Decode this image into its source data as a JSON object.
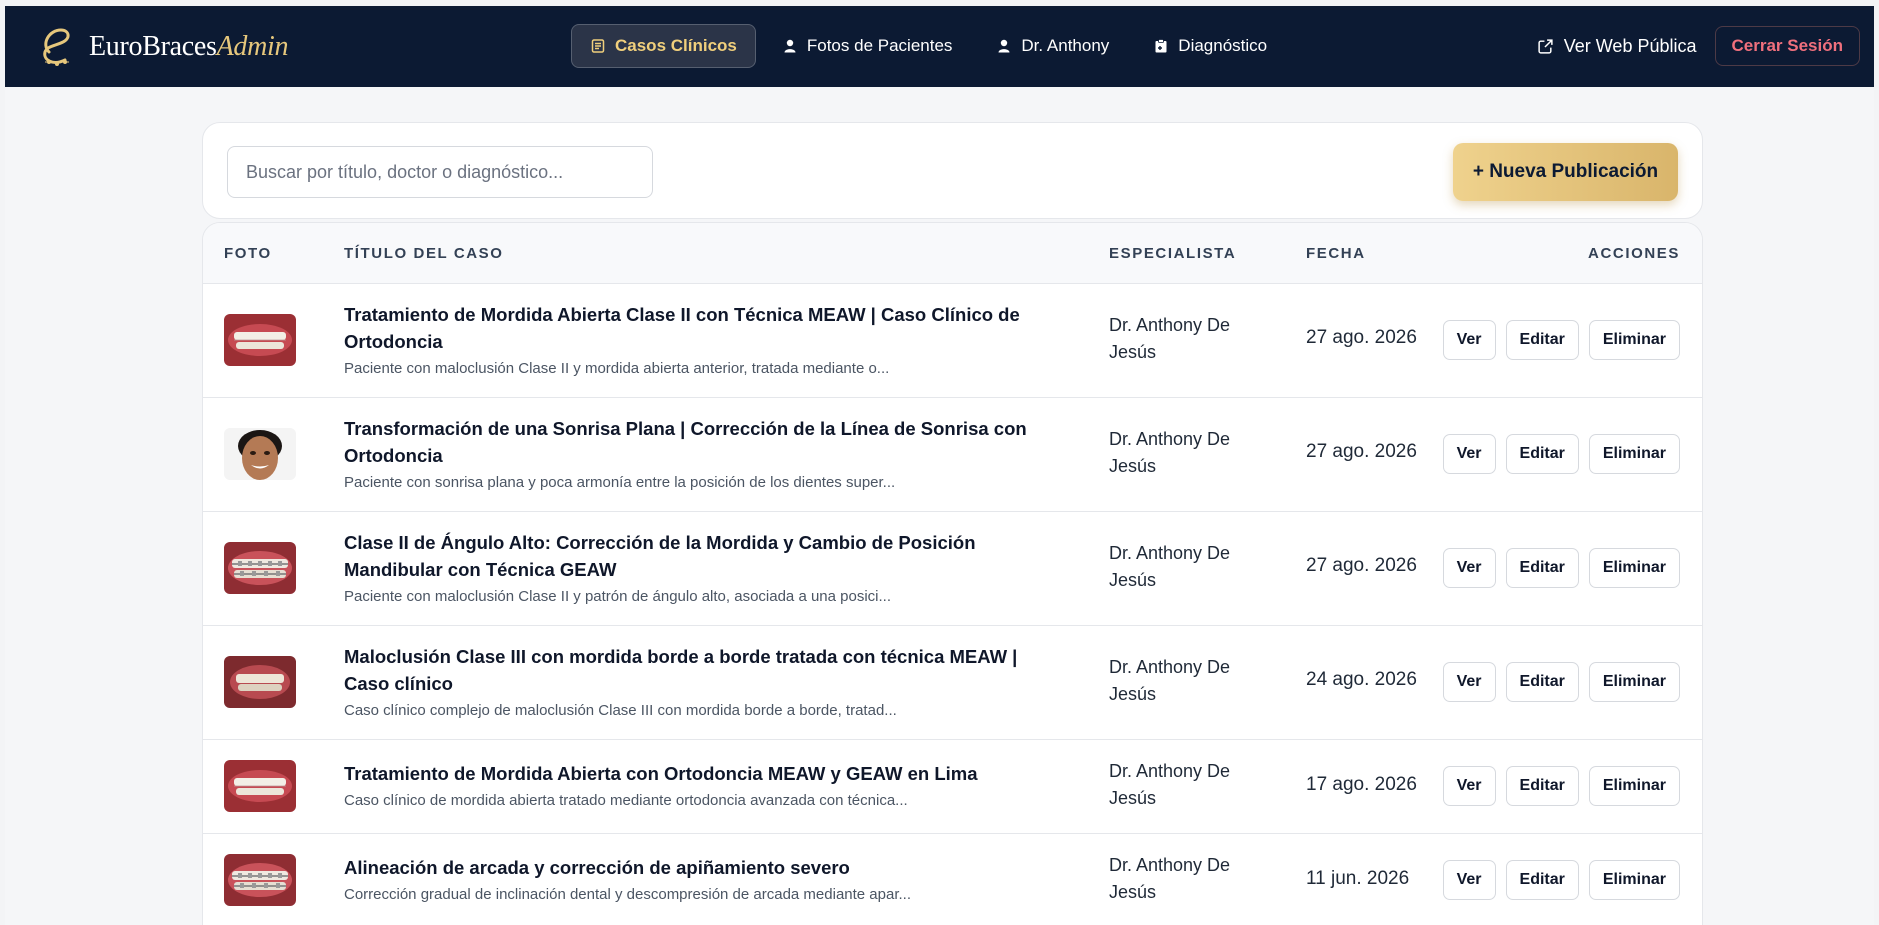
{
  "brand": {
    "name": "EuroBraces",
    "accent": "Admin",
    "logo_icon": "e-monogram-icon"
  },
  "nav": {
    "items": [
      {
        "label": "Casos Clínicos",
        "icon": "document-icon",
        "active": true
      },
      {
        "label": "Fotos de Pacientes",
        "icon": "user-icon"
      },
      {
        "label": "Dr. Anthony",
        "icon": "user-icon"
      },
      {
        "label": "Diagnóstico",
        "icon": "clipboard-icon"
      }
    ],
    "public_link": "Ver Web Pública",
    "logout": "Cerrar Sesión"
  },
  "toolbar": {
    "search_placeholder": "Buscar por título, doctor o diagnóstico...",
    "new_button": "+ Nueva Publicación"
  },
  "table": {
    "headers": {
      "photo": "FOTO",
      "title": "TÍTULO DEL CASO",
      "specialist": "ESPECIALISTA",
      "date": "FECHA",
      "actions": "ACCIONES"
    },
    "action_labels": {
      "view": "Ver",
      "edit": "Editar",
      "delete": "Eliminar"
    },
    "rows": [
      {
        "title": "Tratamiento de Mordida Abierta Clase II con Técnica MEAW | Caso Clínico de Ortodoncia",
        "desc": "Paciente con maloclusión Clase II y mordida abierta anterior, tratada mediante o...",
        "specialist": "Dr. Anthony De Jesús",
        "date": "27 ago. 2026",
        "thumb": "teeth"
      },
      {
        "title": "Transformación de una Sonrisa Plana | Corrección de la Línea de Sonrisa con Ortodoncia",
        "desc": "Paciente con sonrisa plana y poca armonía entre la posición de los dientes super...",
        "specialist": "Dr. Anthony De Jesús",
        "date": "27 ago. 2026",
        "thumb": "face"
      },
      {
        "title": "Clase II de Ángulo Alto: Corrección de la Mordida y Cambio de Posición Mandibular con Técnica GEAW",
        "desc": "Paciente con maloclusión Clase II y patrón de ángulo alto, asociada a una posici...",
        "specialist": "Dr. Anthony De Jesús",
        "date": "27 ago. 2026",
        "thumb": "braces"
      },
      {
        "title": "Maloclusión Clase III con mordida borde a borde tratada con técnica MEAW | Caso clínico",
        "desc": "Caso clínico complejo de maloclusión Clase III con mordida borde a borde, tratad...",
        "specialist": "Dr. Anthony De Jesús",
        "date": "24 ago. 2026",
        "thumb": "teeth2"
      },
      {
        "title": "Tratamiento de Mordida Abierta con Ortodoncia MEAW y GEAW en Lima",
        "desc": "Caso clínico de mordida abierta tratado mediante ortodoncia avanzada con técnica...",
        "specialist": "Dr. Anthony De Jesús",
        "date": "17 ago. 2026",
        "thumb": "teeth"
      },
      {
        "title": "Alineación de arcada y corrección de apiñamiento severo",
        "desc": "Corrección gradual de inclinación dental y descompresión de arcada mediante apar...",
        "specialist": "Dr. Anthony De Jesús",
        "date": "11 jun. 2026",
        "thumb": "braces"
      }
    ]
  },
  "colors": {
    "nav_bg": "#0c1a33",
    "gold": "#e6c77c",
    "danger": "#f0707d"
  }
}
